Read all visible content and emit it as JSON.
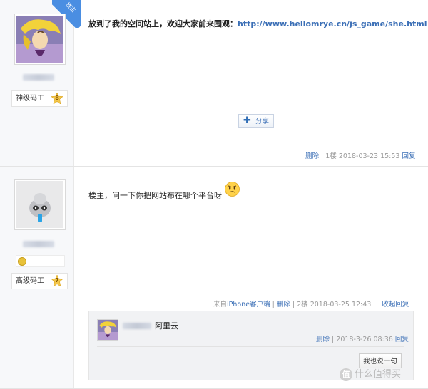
{
  "post1": {
    "host_badge": "楼主",
    "rank_label": "神级码工",
    "rank_level": "8",
    "content": "放到了我的空间站上，欢迎大家前来围观：",
    "link": "http://www.hellomrye.cn/js_game/she.html",
    "share_label": "分享",
    "delete_label": "删除",
    "floor": "1楼",
    "date": "2018-03-23 15:53",
    "reply_label": "回复"
  },
  "post2": {
    "rank_label": "高级码工",
    "rank_level": "7",
    "content": "楼主，问一下你把网站布在哪个平台呀",
    "source_prefix": "来自",
    "source_client": "iPhone客户端",
    "delete_label": "删除",
    "floor": "2楼",
    "date": "2018-03-25 12:43",
    "collapse_reply_label": "收起回复",
    "sub_reply": {
      "text": "阿里云",
      "delete_label": "删除",
      "date": "2018-3-26 08:36",
      "reply_label": "回复"
    },
    "say_button_label": "我也说一句"
  },
  "separator": "|",
  "watermark": {
    "logo_char": "值",
    "text": "什么值得买"
  },
  "colors": {
    "link": "#3b6fb6",
    "meta": "#999999",
    "host_badge": "#4a8ee2"
  }
}
